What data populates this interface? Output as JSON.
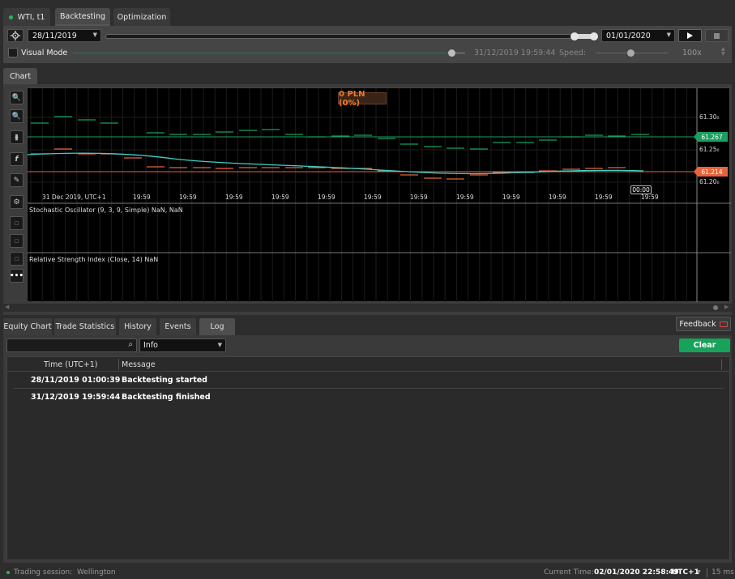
{
  "tabs": [
    {
      "label": "WTI, t1"
    },
    {
      "label": "Backtesting"
    },
    {
      "label": "Optimization"
    }
  ],
  "toolbar": {
    "start_date": "28/11/2019",
    "end_date": "01/01/2020",
    "visual_mode_label": "Visual Mode",
    "visual_mode_checked": false,
    "current_datetime": "31/12/2019 19:59:44",
    "speed_label": "Speed:",
    "speed_value": "100x"
  },
  "chart_tab": {
    "label": "Chart"
  },
  "chart": {
    "pnl": "0 PLN (0%)",
    "price_labels": [
      "61.30₀",
      "61.25₀",
      "61.20₀"
    ],
    "ask_price": "61.267",
    "bid_price": "61.214",
    "x_labels": [
      "31 Dec 2019, UTC+1",
      "19:59",
      "19:59",
      "19:59",
      "19:59",
      "19:59",
      "19:59",
      "19:59",
      "19:59",
      "19:59",
      "19:59",
      "19:59",
      "19:59",
      "19:59"
    ],
    "cursor_time": "00:00",
    "stochastic_label": "Stochastic Oscillator (9, 3, 9, Simple) NaN, NaN",
    "rsi_label": "Relative Strength Index (Close, 14) NaN",
    "colors": {
      "ask": "#1b9e5e",
      "bid": "#e8643a",
      "line": "#40d0c8"
    }
  },
  "bottom_tabs": [
    {
      "label": "Equity Chart"
    },
    {
      "label": "Trade Statistics"
    },
    {
      "label": "History"
    },
    {
      "label": "Events"
    },
    {
      "label": "Log"
    }
  ],
  "feedback_label": "Feedback",
  "log": {
    "search_placeholder": "",
    "level": "Info",
    "clear_label": "Clear",
    "columns": [
      "Time (UTC+1)",
      "Message"
    ],
    "rows": [
      {
        "time": "28/11/2019 01:00:39",
        "message": "Backtesting started"
      },
      {
        "time": "31/12/2019 19:59:44",
        "message": "Backtesting finished"
      }
    ]
  },
  "status": {
    "session_label": "Trading session:",
    "session_value": "Wellington",
    "current_time_label": "Current Time:",
    "current_time": "02/01/2020 22:58:49",
    "tz": "UTC+1",
    "latency": "15 ms"
  }
}
